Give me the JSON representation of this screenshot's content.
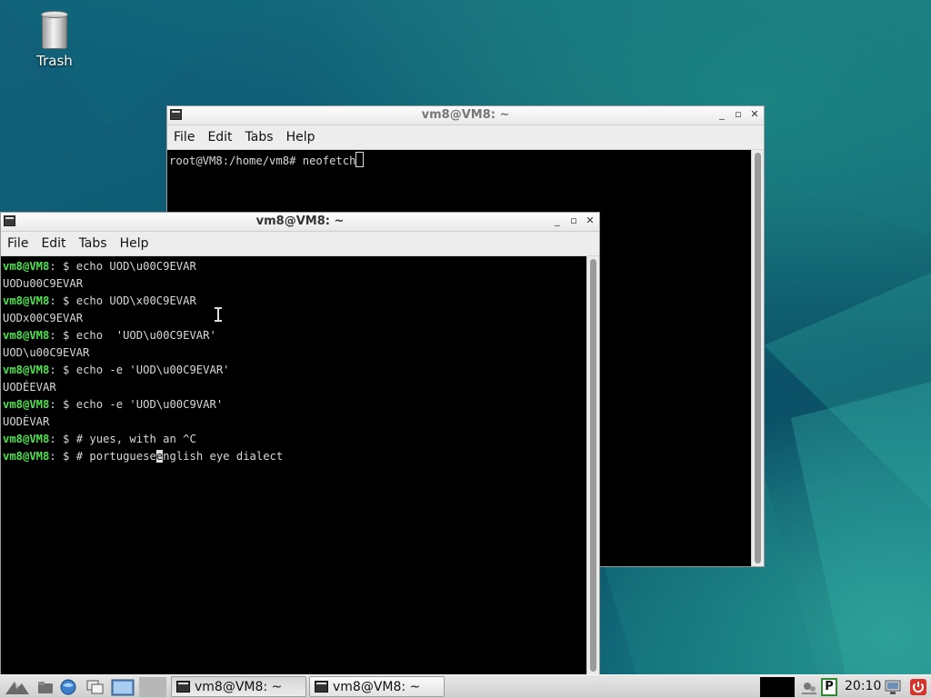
{
  "desktop": {
    "icons": [
      {
        "label": "Trash",
        "icon": "trash-icon"
      }
    ]
  },
  "windows": {
    "back": {
      "title": "vm8@VM8: ~",
      "controls": {
        "minimize": "_",
        "maximize": "▫",
        "close": "✕"
      },
      "menu": [
        "File",
        "Edit",
        "Tabs",
        "Help"
      ],
      "lines": [
        {
          "prompt": "",
          "text": "root@VM8:/home/vm8# neofetch"
        }
      ]
    },
    "front": {
      "title": "vm8@VM8: ~",
      "controls": {
        "minimize": "_",
        "maximize": "▫",
        "close": "✕"
      },
      "menu": [
        "File",
        "Edit",
        "Tabs",
        "Help"
      ],
      "lines": [
        {
          "prompt": "vm8@VM8",
          "sep": ": $ ",
          "text": "echo UOD\\u00C9EVAR"
        },
        {
          "prompt": "",
          "sep": "",
          "text": "UODu00C9EVAR"
        },
        {
          "prompt": "vm8@VM8",
          "sep": ": $ ",
          "text": "echo UOD\\x00C9EVAR"
        },
        {
          "prompt": "",
          "sep": "",
          "text": "UODx00C9EVAR"
        },
        {
          "prompt": "vm8@VM8",
          "sep": ": $ ",
          "text": "echo  'UOD\\u00C9EVAR'"
        },
        {
          "prompt": "",
          "sep": "",
          "text": "UOD\\u00C9EVAR"
        },
        {
          "prompt": "vm8@VM8",
          "sep": ": $ ",
          "text": "echo -e 'UOD\\u00C9EVAR'"
        },
        {
          "prompt": "",
          "sep": "",
          "text": "UODÉEVAR"
        },
        {
          "prompt": "vm8@VM8",
          "sep": ": $ ",
          "text": "echo -e 'UOD\\u00C9VAR'"
        },
        {
          "prompt": "",
          "sep": "",
          "text": "UODÉVAR"
        },
        {
          "prompt": "vm8@VM8",
          "sep": ": $ ",
          "text": "# yues, with an ^C"
        },
        {
          "prompt": "vm8@VM8",
          "sep": ": $ ",
          "text_before": "# portuguese",
          "cursor_char": "e",
          "text_after": "nglish eye dialect"
        }
      ]
    }
  },
  "taskbar": {
    "tasks": [
      {
        "label": "vm8@VM8: ~",
        "active": true
      },
      {
        "label": "vm8@VM8: ~",
        "active": false
      }
    ],
    "clock": "20:10",
    "tray_letter": "P"
  }
}
